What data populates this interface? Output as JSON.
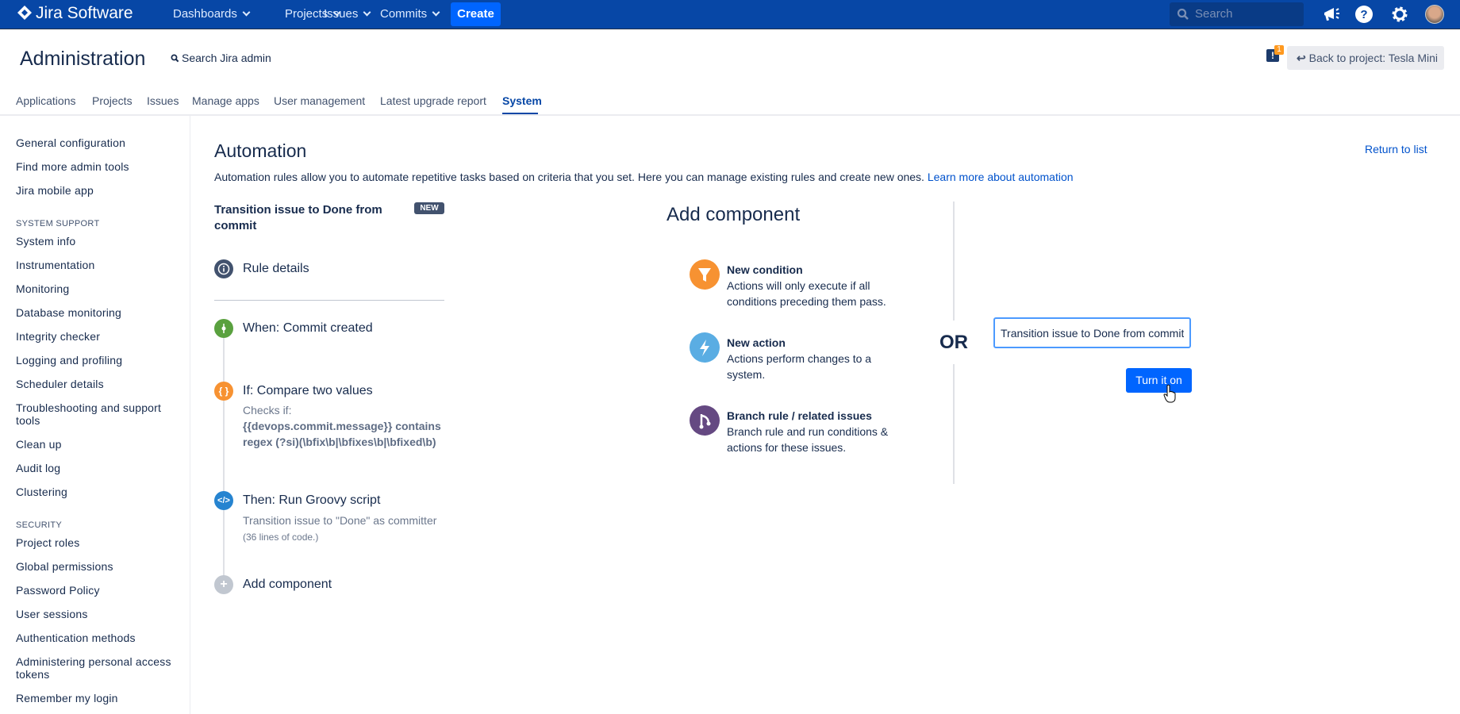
{
  "topbar": {
    "logo": "Jira Software",
    "nav": [
      {
        "label": "Dashboards"
      },
      {
        "label": "Projects"
      },
      {
        "label": "Issues"
      },
      {
        "label": "Commits"
      }
    ],
    "create": "Create",
    "search_placeholder": "Search",
    "brand_color": "#0747a6"
  },
  "header": {
    "title": "Administration",
    "search_admin": "Search Jira admin",
    "notification_count": "1",
    "back_button": "Back to project: Tesla Mini"
  },
  "tabs": [
    {
      "label": "Applications"
    },
    {
      "label": "Projects"
    },
    {
      "label": "Issues"
    },
    {
      "label": "Manage apps"
    },
    {
      "label": "User management"
    },
    {
      "label": "Latest upgrade report"
    },
    {
      "label": "System",
      "active": true
    }
  ],
  "sidebar": {
    "top": [
      "General configuration",
      "Find more admin tools",
      "Jira mobile app"
    ],
    "system_support_heading": "SYSTEM SUPPORT",
    "system_support": [
      "System info",
      "Instrumentation",
      "Monitoring",
      "Database monitoring",
      "Integrity checker",
      "Logging and profiling",
      "Scheduler details",
      "Troubleshooting and support tools",
      "Clean up",
      "Audit log",
      "Clustering"
    ],
    "security_heading": "SECURITY",
    "security": [
      "Project roles",
      "Global permissions",
      "Password Policy",
      "User sessions",
      "Authentication methods",
      "Administering personal access tokens",
      "Remember my login"
    ]
  },
  "main": {
    "title": "Automation",
    "return_link": "Return to list",
    "description": "Automation rules allow you to automate repetitive tasks based on criteria that you set. Here you can manage existing rules and create new ones.",
    "learn_more": "Learn more about automation",
    "rule": {
      "name": "Transition issue to Done from commit",
      "badge": "NEW",
      "details": "Rule details",
      "trigger": "When: Commit created",
      "condition": {
        "title": "If: Compare two values",
        "checks": "Checks if:",
        "expr1": "{{devops.commit.message}} contains",
        "expr2": "regex (?si)(\\bfix\\b|\\bfixes\\b|\\bfixed\\b)"
      },
      "action": {
        "title": "Then: Run Groovy script",
        "desc": "Transition issue to \"Done\" as committer",
        "lines": "(36 lines of code.)"
      },
      "add": "Add component"
    },
    "add_component": {
      "title": "Add component",
      "options": [
        {
          "title": "New condition",
          "desc": "Actions will only execute if all conditions preceding them pass.",
          "icon": "filter-icon",
          "color": "#f79232"
        },
        {
          "title": "New action",
          "desc": "Actions perform changes to a system.",
          "icon": "lightning-icon",
          "color": "#5aade3"
        },
        {
          "title": "Branch rule / related issues",
          "desc": "Branch rule and run conditions & actions for these issues.",
          "icon": "branch-icon",
          "color": "#654982"
        }
      ]
    },
    "or": "OR",
    "rule_name_input": "Transition issue to Done from commit",
    "turn_on": "Turn it on"
  }
}
